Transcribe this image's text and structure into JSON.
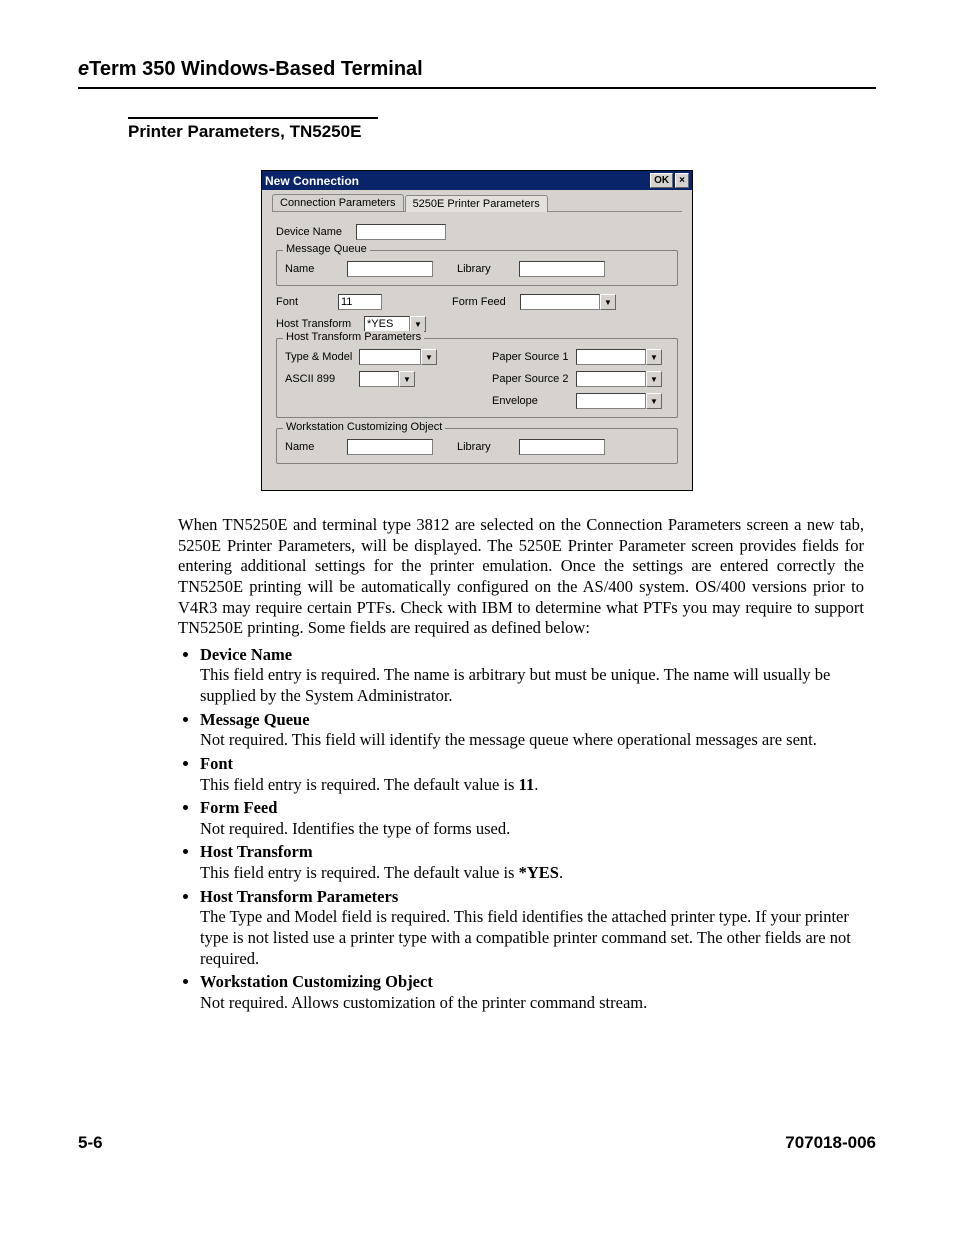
{
  "header": {
    "prefix": "e",
    "title_rest": "Term 350 Windows-Based Terminal"
  },
  "section_heading": "Printer Parameters, TN5250E",
  "dialog": {
    "title": "New Connection",
    "ok": "OK",
    "close": "×",
    "tabs": {
      "conn": "Connection Parameters",
      "printer": "5250E Printer Parameters"
    },
    "labels": {
      "device_name": "Device Name",
      "message_queue": "Message Queue",
      "name": "Name",
      "library": "Library",
      "font": "Font",
      "font_value": "11",
      "form_feed": "Form Feed",
      "host_transform": "Host Transform",
      "host_transform_value": "*YES",
      "htp": "Host Transform Parameters",
      "type_model": "Type & Model",
      "ascii899": "ASCII 899",
      "paper1": "Paper Source 1",
      "paper2": "Paper Source 2",
      "envelope": "Envelope",
      "wco": "Workstation Customizing Object"
    }
  },
  "paragraph": "When TN5250E and terminal type 3812 are selected on the Connection Parameters screen a new tab, 5250E Printer Parameters, will be displayed. The 5250E Printer Parameter screen provides fields for entering additional settings for the printer emulation. Once the settings are entered correctly the TN5250E printing will be automatically configured on the AS/400 system. OS/400 versions prior to V4R3 may require certain PTFs. Check with IBM to determine what PTFs you may require to support TN5250E printing. Some fields are required as defined below:",
  "defs": [
    {
      "term": "Device Name",
      "desc": "This field entry is required. The name is arbitrary but must be unique. The name will usually be supplied by the System Administrator."
    },
    {
      "term": "Message Queue",
      "desc": "Not required. This field will identify the message queue where operational messages are sent."
    },
    {
      "term": "Font",
      "desc_pre": "This field entry is required. The default value is ",
      "desc_strong": "11",
      "desc_post": "."
    },
    {
      "term": "Form Feed",
      "desc": "Not required. Identifies the type of forms used."
    },
    {
      "term": "Host Transform",
      "desc_pre": "This field entry is required. The default value is ",
      "desc_strong": "*YES",
      "desc_post": "."
    },
    {
      "term": "Host Transform Parameters",
      "desc": "The Type and Model field is required. This field identifies the attached printer type. If your printer type is not listed use a printer type with a compatible printer command set. The other fields are not required."
    },
    {
      "term": "Workstation Customizing Object",
      "desc": "Not required. Allows customization of the printer command stream."
    }
  ],
  "footer": {
    "page": "5-6",
    "doc": "707018-006"
  }
}
